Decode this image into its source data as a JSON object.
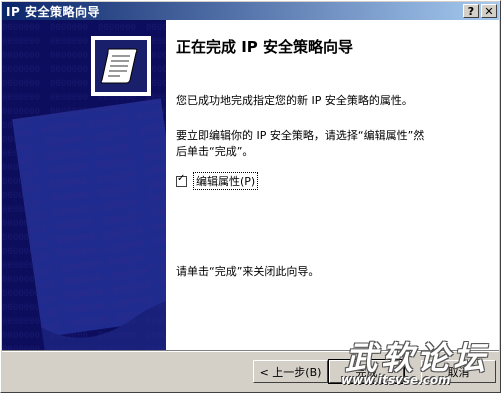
{
  "window": {
    "title": "IP 安全策略向导",
    "help_glyph": "?",
    "close_glyph": "✕"
  },
  "content": {
    "heading": "正在完成 IP 安全策略向导",
    "para1": "您已成功地完成指定您的新 IP 安全策略的属性。",
    "para2_line1": "要立即编辑你的 IP 安全策略，请选择“编辑属性”然",
    "para2_line2": "后单击“完成”。",
    "checkbox_label": "编辑属性(P)",
    "checkbox_checked": true,
    "para3": "请单击“完成”来关闭此向导。"
  },
  "buttons": {
    "back": "< 上一步(B)",
    "finish": "完成",
    "cancel": "取消"
  },
  "watermark": {
    "brand": "武软论坛",
    "url": "www.itsvse.com"
  },
  "colors": {
    "title_start": "#0a246a",
    "title_end": "#a6caf0",
    "left_panel": "#0d0d5e",
    "face": "#d4d0c8"
  },
  "icons": [
    "document-scroll-icon",
    "help-icon",
    "close-icon",
    "check-icon"
  ]
}
